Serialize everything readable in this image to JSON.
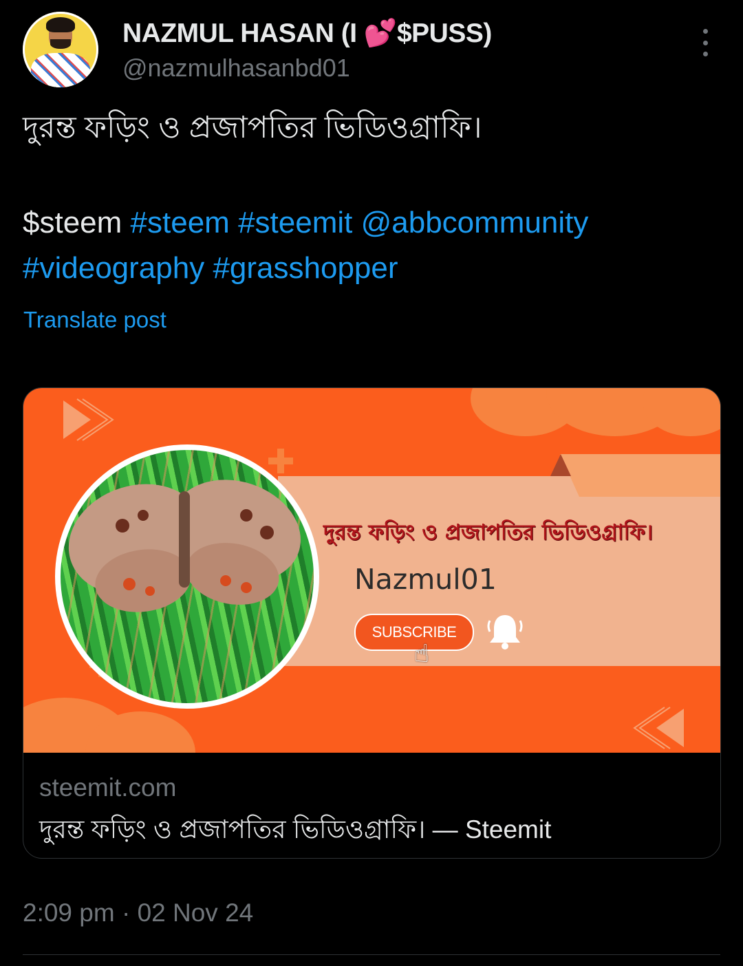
{
  "author": {
    "display_name_prefix": "NAZMUL HASAN (I ",
    "display_name_emoji": "💕",
    "display_name_suffix": "$PUSS)",
    "handle": "@nazmulhasanbd01"
  },
  "tweet": {
    "text_line1": "দুরন্ত ফড়িং ও প্রজাপতির ভিডিওগ্রাফি।",
    "cashtag": "$steem",
    "tag_steem": "#steem",
    "tag_steemit": "#steemit",
    "mention": "@abbcommunity",
    "tag_videography": "#videography",
    "tag_grasshopper": "#grasshopper",
    "translate_label": "Translate post"
  },
  "card": {
    "banner_title": "দুরন্ত ফড়িং ও প্রজাপতির ভিডিওগ্রাফি।",
    "channel_name": "Nazmul01",
    "subscribe_label": "SUBSCRIBE",
    "domain": "steemit.com",
    "title": "দুরন্ত ফড়িং ও প্রজাপতির ভিডিওগ্রাফি। — Steemit"
  },
  "meta": {
    "timestamp": "2:09 pm · 02 Nov 24"
  },
  "colors": {
    "background": "#000000",
    "link": "#1d9bf0",
    "muted": "#71767b",
    "banner_orange": "#fb5d1d"
  }
}
